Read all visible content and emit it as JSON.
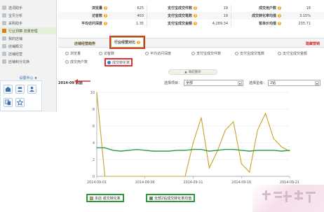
{
  "sidebar": {
    "items": [
      {
        "label": "选词助手",
        "active": false
      },
      {
        "label": "宝贝分析",
        "active": false
      },
      {
        "label": "采购助手",
        "active": false
      },
      {
        "label": "行业洞察·流量管理",
        "active": true
      },
      {
        "label": "我的店铺",
        "active": false
      },
      {
        "label": "店铺概况",
        "active": false
      },
      {
        "label": "店铺经营",
        "active": false
      },
      {
        "label": "店铺积分兑换",
        "active": false
      }
    ],
    "settings_label": "设置中心",
    "tool_icons": [
      "shop-icon",
      "users-icon",
      "user-icon",
      "person-icon",
      "copy-icon",
      "star-icon"
    ]
  },
  "stats": {
    "rows": [
      [
        {
          "label": "浏览量",
          "value": "625"
        },
        {
          "label": "支付宝成交件数",
          "value": "19"
        },
        {
          "label": "成交用户数",
          "value": "18"
        }
      ],
      [
        {
          "label": "访客数",
          "value": "403"
        },
        {
          "label": "支付宝成交笔数",
          "value": "19"
        },
        {
          "label": "成交转化率均值",
          "value": "3.15%"
        }
      ],
      [
        {
          "label": "平均访问深度",
          "value": "1.35"
        },
        {
          "label": "支付宝成交金额",
          "value": "4,289.34"
        },
        {
          "label": "客单价均值",
          "value": "235.71"
        }
      ]
    ]
  },
  "tabs": {
    "trend": "店铺经营趋势",
    "compare": "行业经营对比",
    "trend_link": "隐藏营销"
  },
  "metrics": {
    "row1": [
      {
        "label": "浏览量",
        "checked": false
      },
      {
        "label": "访客数",
        "checked": false
      },
      {
        "label": "平均访问深度",
        "checked": false
      },
      {
        "label": "支付宝成交件数",
        "checked": false
      },
      {
        "label": "支付宝成交笔数",
        "checked": false
      },
      {
        "label": "支付宝成交金额",
        "checked": false
      }
    ],
    "row2": [
      {
        "label": "成交用户数",
        "checked": false
      },
      {
        "label": "成交转化率",
        "checked": true
      }
    ],
    "collapse_label": "收起图形"
  },
  "chart_header": {
    "title": "2014-09 数据",
    "project_label": "选择项目：",
    "project_value": "全部",
    "level_label": "选择星级：",
    "level_value": "2钻"
  },
  "chart_data": {
    "type": "line",
    "x_ticks": [
      "2014-09-01",
      "2014-09-06",
      "2014-09-11",
      "2014-09-16",
      "2014-09-21"
    ],
    "y_ticks": [
      "0",
      "2",
      "4",
      "6",
      "8",
      "10"
    ],
    "ylim": [
      0,
      10
    ],
    "series": [
      {
        "name": "本店 成交转化率",
        "color": "#c9a227",
        "values": [
          10,
          0,
          0,
          0,
          0,
          0,
          0,
          0,
          0,
          0,
          0,
          0,
          4.0,
          7.0,
          1.0,
          3.0,
          5.5,
          6.5,
          1.5,
          0.5,
          5.5,
          7.5,
          4.5,
          3.5,
          3.0
        ]
      },
      {
        "name": "全部2钻成交转化率均值",
        "color": "#2f9a45",
        "values": [
          3.4,
          3.4,
          3.1,
          3.0,
          3.1,
          3.2,
          3.1,
          3.0,
          3.0,
          3.0,
          3.1,
          3.1,
          3.2,
          3.2,
          3.0,
          3.1,
          3.2,
          3.2,
          3.1,
          3.0,
          3.1,
          3.1,
          3.1,
          3.0,
          3.1
        ]
      }
    ]
  }
}
